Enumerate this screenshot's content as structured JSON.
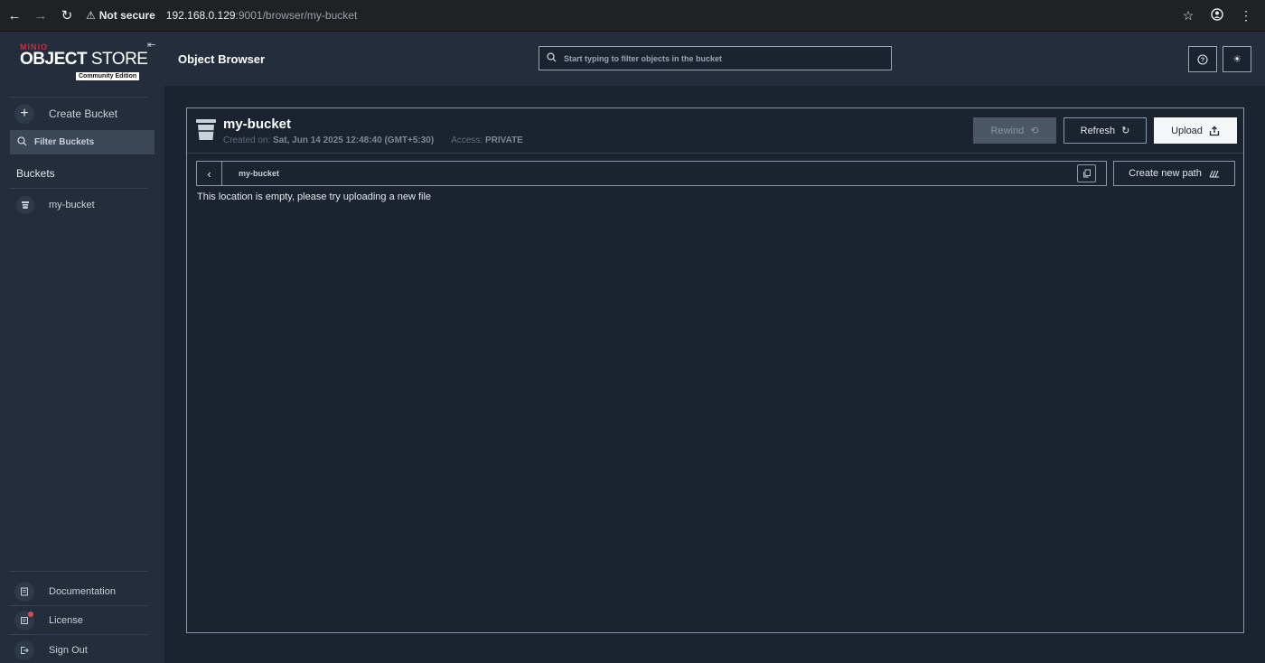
{
  "browser": {
    "security_label": "Not secure",
    "url_host": "192.168.0.129",
    "url_path": ":9001/browser/my-bucket"
  },
  "sidebar": {
    "logo_brand": "MINIO",
    "logo_product_bold": "OBJECT",
    "logo_product_light": " STORE",
    "logo_edition": "Community Edition",
    "create_bucket_label": "Create Bucket",
    "filter_placeholder": "Filter Buckets",
    "buckets_title": "Buckets",
    "buckets": [
      {
        "label": "my-bucket"
      }
    ],
    "bottom_items": [
      {
        "label": "Documentation"
      },
      {
        "label": "License"
      },
      {
        "label": "Sign Out"
      }
    ]
  },
  "header": {
    "title": "Object Browser",
    "search_placeholder": "Start typing to filter objects in the bucket"
  },
  "bucket": {
    "name": "my-bucket",
    "created_label": "Created on:",
    "created_value": "Sat, Jun 14 2025 12:48:40 (GMT+5:30)",
    "access_label": "Access:",
    "access_value": "PRIVATE",
    "rewind_label": "Rewind",
    "refresh_label": "Refresh",
    "upload_label": "Upload",
    "path_crumb": "my-bucket",
    "create_path_label": "Create new path",
    "empty_message": "This location is empty, please try uploading a new file"
  },
  "colors": {
    "page_bg": "#1b2230",
    "sidebar_bg": "#232d3b",
    "brand_red": "#c72c48",
    "license_dot": "#e0455f"
  }
}
